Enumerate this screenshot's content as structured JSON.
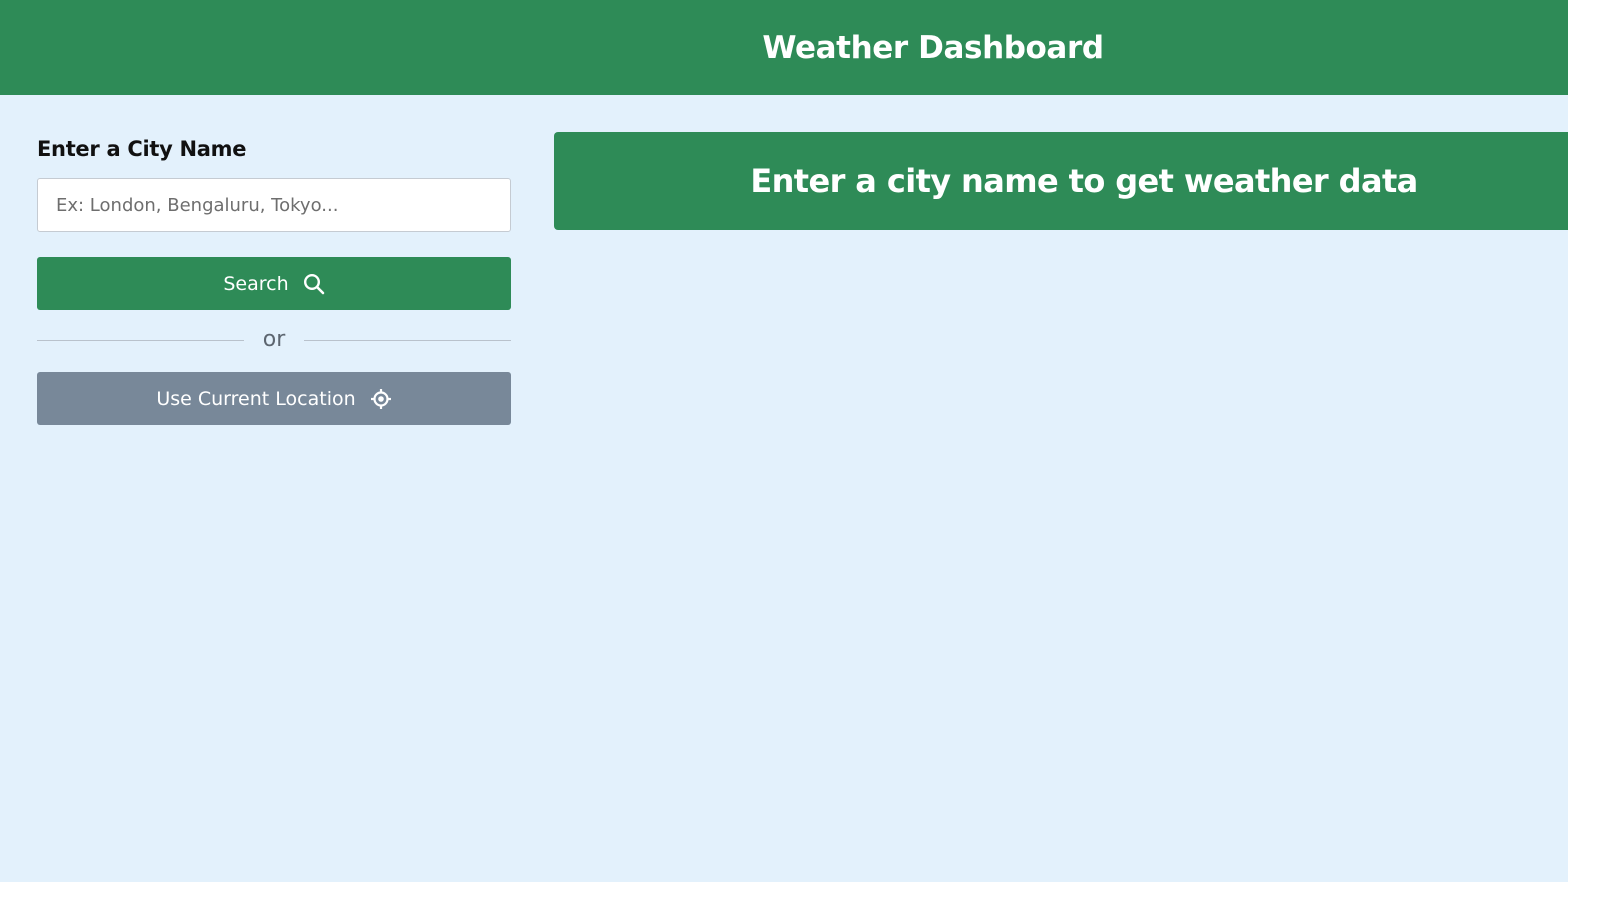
{
  "header": {
    "title": "Weather Dashboard"
  },
  "sidebar": {
    "city_label": "Enter a City Name",
    "city_input": {
      "value": "",
      "placeholder": "Ex: London, Bengaluru, Tokyo..."
    },
    "search_button": {
      "label": "Search",
      "icon": "search-icon"
    },
    "divider_text": "or",
    "location_button": {
      "label": "Use Current Location",
      "icon": "crosshair-icon"
    }
  },
  "main": {
    "message": "Enter a city name to get weather data"
  },
  "colors": {
    "brand_green": "#2e8b57",
    "page_background": "#e3f1fc",
    "location_button": "#788899"
  }
}
